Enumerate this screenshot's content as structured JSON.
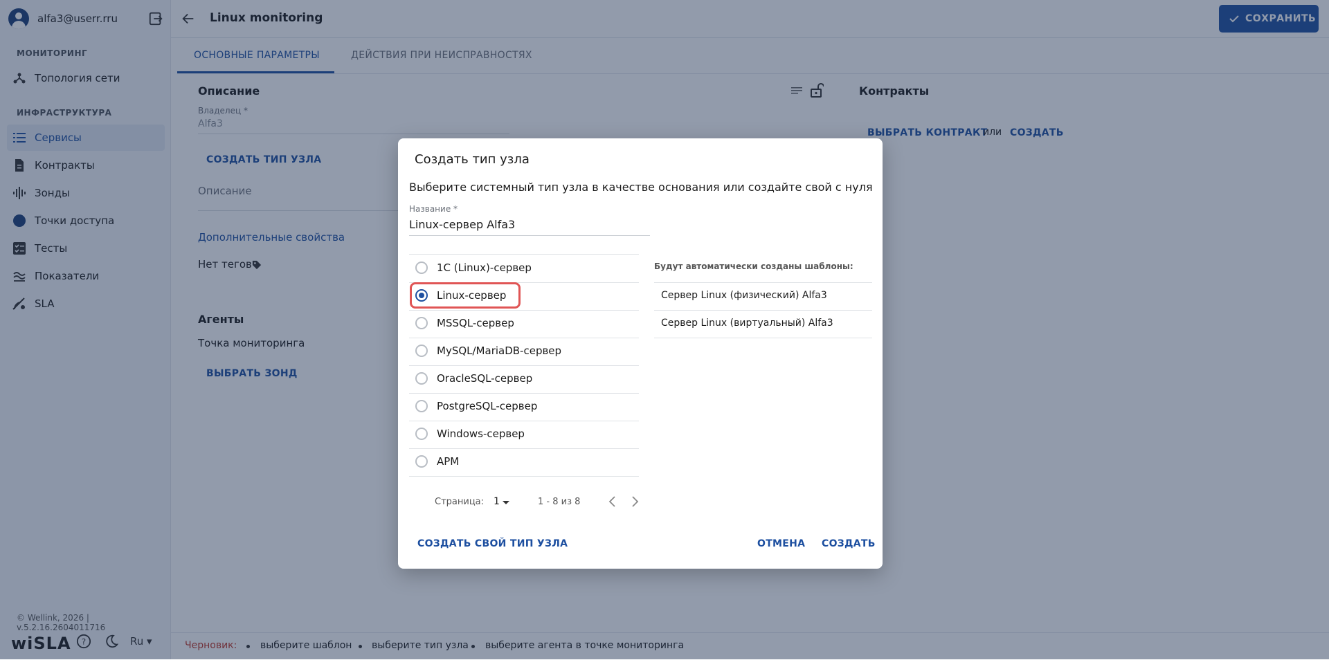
{
  "user": {
    "email": "alfa3@userr.rru"
  },
  "sidebar": {
    "section_monitoring": "МОНИТОРИНГ",
    "section_infra": "ИНФРАСТРУКТУРА",
    "items": [
      {
        "label": "Топология сети",
        "icon": "topology-icon"
      },
      {
        "label": "Сервисы",
        "icon": "list-icon",
        "active": true
      },
      {
        "label": "Контракты",
        "icon": "document-icon"
      },
      {
        "label": "Зонды",
        "icon": "probe-icon"
      },
      {
        "label": "Точки доступа",
        "icon": "access-point-icon"
      },
      {
        "label": "Тесты",
        "icon": "tests-icon"
      },
      {
        "label": "Показатели",
        "icon": "metrics-icon"
      },
      {
        "label": "SLA",
        "icon": "sla-icon"
      }
    ],
    "copyright": "© Wellink, 2026 | v.5.2.16.2604011716",
    "brand": "wiSLA",
    "lang": "Ru"
  },
  "header": {
    "title": "Linux monitoring",
    "save_label": "СОХРАНИТЬ"
  },
  "tabs": [
    "ОСНОВНЫЕ ПАРАМЕТРЫ",
    "ДЕЙСТВИЯ ПРИ НЕИСПРАВНОСТЯХ"
  ],
  "form": {
    "description_title": "Описание",
    "owner_label": "Владелец *",
    "owner_value": "Alfa3",
    "create_node_type": "СОЗДАТЬ ТИП УЗЛА",
    "description_placeholder": "Описание",
    "extra_props": "Дополнительные свойства",
    "no_tags": "Нет тегов",
    "agents_title": "Агенты",
    "monitoring_point": "Точка мониторинга",
    "select_probe": "ВЫБРАТЬ ЗОНД"
  },
  "contracts": {
    "title": "Контракты",
    "select": "ВЫБРАТЬ КОНТРАКТ",
    "or": "или",
    "create": "СОЗДАТЬ"
  },
  "bottom": {
    "draft_label": "Черновик:",
    "items": [
      "выберите шаблон",
      "выберите тип узла",
      "выберите агента в точке мониторинга"
    ]
  },
  "dialog": {
    "title": "Создать тип узла",
    "subtitle": "Выберите системный тип узла в качестве основания или создайте свой с нуля",
    "name_label": "Название *",
    "name_value": "Linux-сервер Alfa3",
    "options": [
      {
        "label": "1С (Linux)-сервер",
        "selected": false
      },
      {
        "label": "Linux-сервер",
        "selected": true
      },
      {
        "label": "MSSQL-сервер",
        "selected": false
      },
      {
        "label": "MySQL/MariaDB-сервер",
        "selected": false
      },
      {
        "label": "OracleSQL-сервер",
        "selected": false
      },
      {
        "label": "PostgreSQL-сервер",
        "selected": false
      },
      {
        "label": "Windows-сервер",
        "selected": false
      },
      {
        "label": "АРМ",
        "selected": false
      }
    ],
    "templates_label": "Будут автоматически созданы шаблоны:",
    "templates": [
      "Сервер Linux (физический) Alfa3",
      "Сервер Linux (виртуальный) Alfa3"
    ],
    "page_label": "Страница:",
    "page_value": "1",
    "page_range": "1 - 8 из 8",
    "create_own": "СОЗДАТЬ СВОЙ ТИП УЗЛА",
    "cancel": "ОТМЕНА",
    "create": "СОЗДАТЬ"
  },
  "colors": {
    "accent": "#1d4fa0",
    "draft": "#c0392b",
    "highlight": "#e05555"
  }
}
